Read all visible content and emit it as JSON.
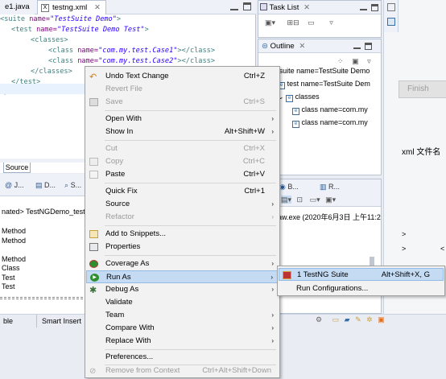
{
  "editor": {
    "tabs": [
      {
        "label": "e1.java"
      },
      {
        "label": "testng.xml"
      }
    ],
    "lines": [
      {
        "open": "<",
        "tag": "suite",
        "attr": " name=",
        "val": "\"TestSuite Demo\"",
        "close": ">"
      },
      {
        "open": "<",
        "tag": "test",
        "attr": " name=",
        "val": "\"TestSuite Demo Test\"",
        "close": ">"
      },
      {
        "open": "<",
        "tag": "classes",
        "attr": "",
        "val": "",
        "close": ">"
      },
      {
        "open": "<",
        "tag": "class",
        "attr": " name=",
        "val": "\"com.my.test.Case1\"",
        "close": "></class>"
      },
      {
        "open": "<",
        "tag": "class",
        "attr": " name=",
        "val": "\"com.my.test.Case2\"",
        "close": "></class>"
      },
      {
        "open": "</",
        "tag": "classes",
        "attr": "",
        "val": "",
        "close": ">"
      },
      {
        "open": "</",
        "tag": "test",
        "attr": "",
        "val": "",
        "close": ">"
      },
      {
        "open": "</",
        "tag": "suite",
        "attr": "",
        "val": "",
        "close": ">"
      }
    ],
    "bottom_tab": "Source"
  },
  "console": {
    "tabs": [
      "J...",
      "D...",
      "S..."
    ],
    "title": "nated> TestNGDemo_test",
    "lines": [
      "Method",
      "Method",
      "",
      "Method",
      "Class",
      "Test",
      "Test"
    ],
    "process_line": "aw.exe (2020年6月3日 上午11:2",
    "right_tabs": [
      "B...",
      "R..."
    ]
  },
  "status_bar": {
    "left": "ble",
    "mode": "Smart Insert"
  },
  "task_list": {
    "title": "Task List"
  },
  "outline": {
    "title": "Outline",
    "items": [
      {
        "text": "suite name=TestSuite Demo",
        "indent": 0
      },
      {
        "text": "test name=TestSuite Dem",
        "indent": 1
      },
      {
        "text": "classes",
        "indent": 2
      },
      {
        "text": "class name=com.my",
        "indent": 3
      },
      {
        "text": "class name=com.my",
        "indent": 3
      }
    ]
  },
  "right_fragments": {
    "finish": "Finish",
    "xml_text": "xml 文件名",
    "arrow1": ">",
    "arrow2": ">",
    "arrow3": "<"
  },
  "context_menu": {
    "items": [
      {
        "label": "Undo Text Change",
        "shortcut": "Ctrl+Z",
        "icon": "undo-icon",
        "enabled": true
      },
      {
        "label": "Revert File",
        "shortcut": "",
        "enabled": false
      },
      {
        "label": "Save",
        "shortcut": "Ctrl+S",
        "icon": "save-icon",
        "enabled": false
      },
      {
        "label": "Open With",
        "submenu": true,
        "enabled": true
      },
      {
        "label": "Show In",
        "shortcut": "Alt+Shift+W",
        "submenu": true,
        "enabled": true
      },
      {
        "label": "Cut",
        "shortcut": "Ctrl+X",
        "enabled": false
      },
      {
        "label": "Copy",
        "shortcut": "Ctrl+C",
        "icon": "copy-icon",
        "enabled": false
      },
      {
        "label": "Paste",
        "shortcut": "Ctrl+V",
        "icon": "paste-icon",
        "enabled": true
      },
      {
        "label": "Quick Fix",
        "shortcut": "Ctrl+1",
        "enabled": true
      },
      {
        "label": "Source",
        "submenu": true,
        "enabled": true
      },
      {
        "label": "Refactor",
        "submenu": true,
        "enabled": false
      },
      {
        "label": "Add to Snippets...",
        "icon": "snippet-icon",
        "enabled": true
      },
      {
        "label": "Properties",
        "icon": "properties-icon",
        "enabled": true
      },
      {
        "label": "Coverage As",
        "submenu": true,
        "icon": "coverage-icon",
        "enabled": true
      },
      {
        "label": "Run As",
        "submenu": true,
        "icon": "run-icon",
        "enabled": true,
        "selected": true
      },
      {
        "label": "Debug As",
        "submenu": true,
        "icon": "debug-icon",
        "enabled": true
      },
      {
        "label": "Validate",
        "enabled": true
      },
      {
        "label": "Team",
        "submenu": true,
        "enabled": true
      },
      {
        "label": "Compare With",
        "submenu": true,
        "enabled": true
      },
      {
        "label": "Replace With",
        "submenu": true,
        "enabled": true
      },
      {
        "label": "Preferences...",
        "enabled": true
      },
      {
        "label": "Remove from Context",
        "shortcut": "Ctrl+Alt+Shift+Down",
        "icon": "remove-context-icon",
        "enabled": false
      }
    ]
  },
  "run_as_submenu": {
    "items": [
      {
        "label": "1 TestNG Suite",
        "shortcut": "Alt+Shift+X, G",
        "icon": "testng-icon"
      },
      {
        "label": "Run Configurations..."
      }
    ]
  },
  "colors": {
    "selection": "#c4dbf3",
    "menu_bg": "#f2f2f2",
    "run_green": "#2f8f2f"
  }
}
